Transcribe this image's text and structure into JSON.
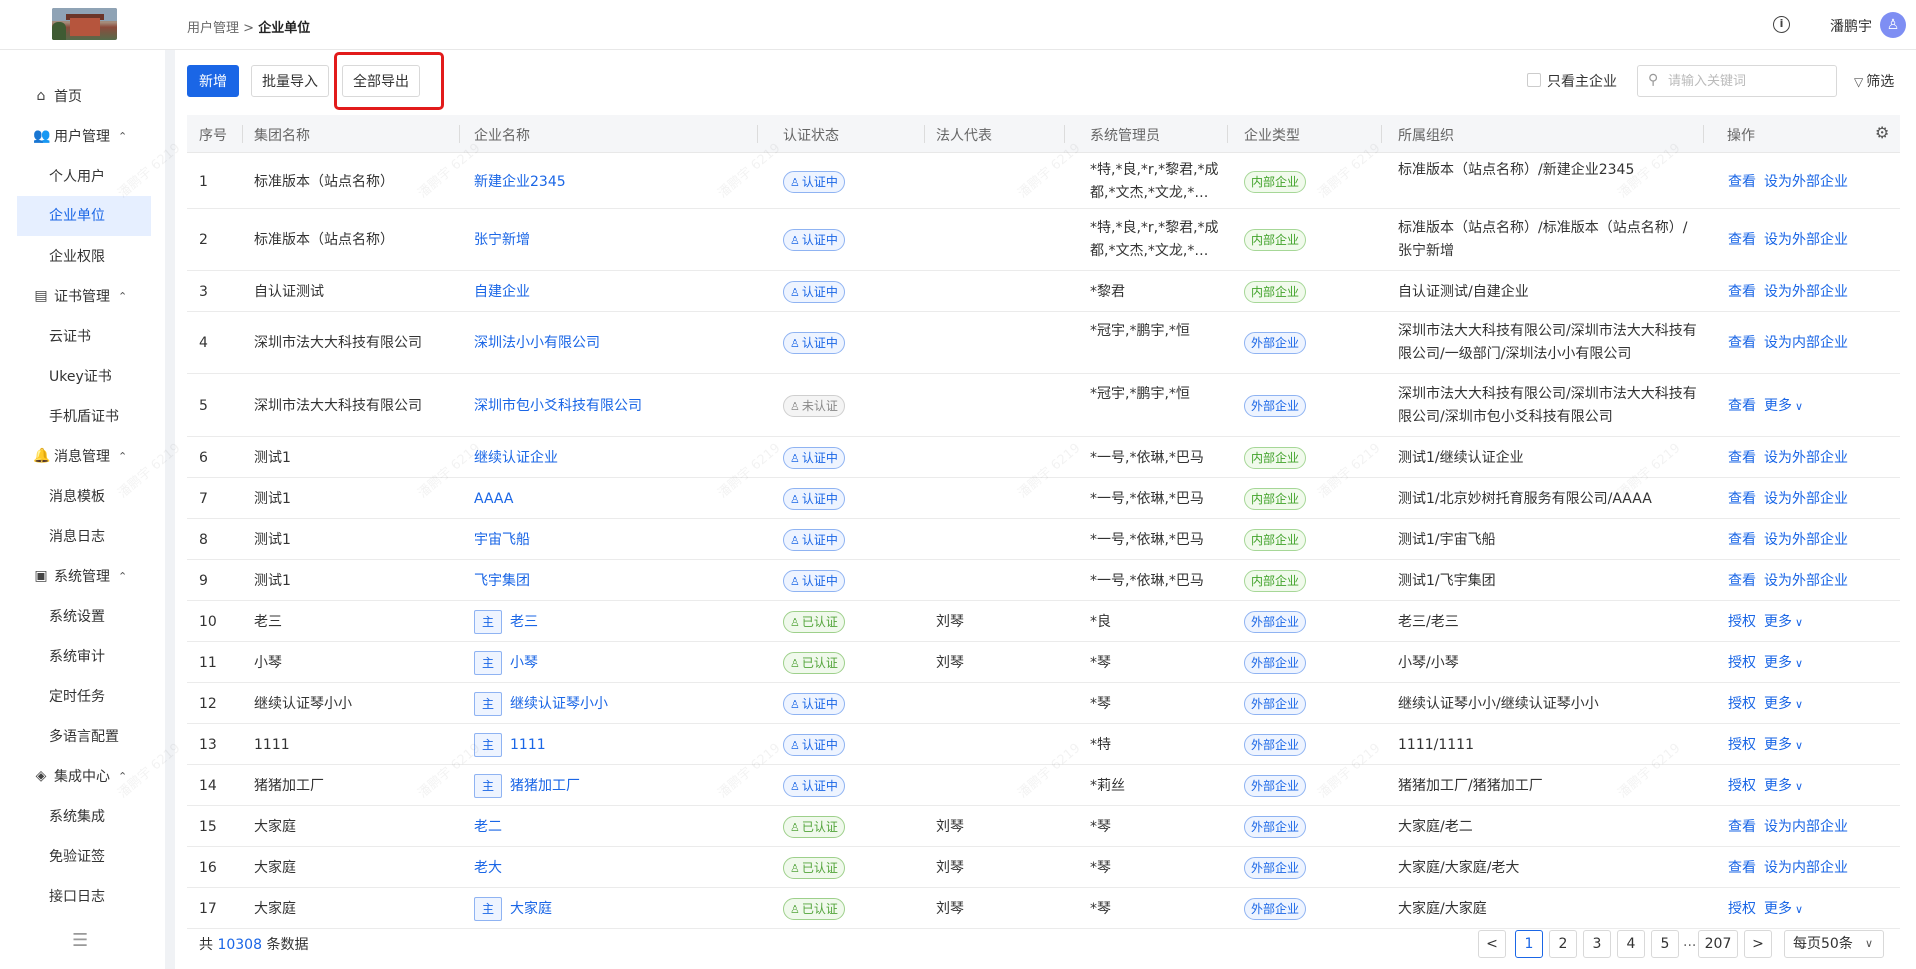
{
  "header": {
    "breadcrumb_parent": "用户管理",
    "breadcrumb_sep": ">",
    "breadcrumb_current": "企业单位",
    "info_icon": "i",
    "username": "潘鹏宇",
    "avatar_glyph": "♙"
  },
  "sidebar": {
    "home": "首页",
    "user_mgmt": "用户管理",
    "personal_user": "个人用户",
    "enterprise_unit": "企业单位",
    "enterprise_perm": "企业权限",
    "cert_mgmt": "证书管理",
    "cloud_cert": "云证书",
    "ukey_cert": "Ukey证书",
    "phone_cert": "手机盾证书",
    "msg_mgmt": "消息管理",
    "msg_template": "消息模板",
    "msg_log": "消息日志",
    "sys_mgmt": "系统管理",
    "sys_settings": "系统设置",
    "sys_audit": "系统审计",
    "sched_task": "定时任务",
    "multilang": "多语言配置",
    "integration": "集成中心",
    "sys_integration": "系统集成",
    "no_verify_sign": "免验证签",
    "api_log": "接口日志"
  },
  "toolbar": {
    "add": "新增",
    "batch_import": "批量导入",
    "export_all": "全部导出",
    "only_main": "只看主企业",
    "search_placeholder": "请输入关键词",
    "filter": "筛选"
  },
  "table": {
    "headers": {
      "index": "序号",
      "group": "集团名称",
      "company": "企业名称",
      "cert_status": "认证状态",
      "legal_rep": "法人代表",
      "sys_admin": "系统管理员",
      "ent_type": "企业类型",
      "org": "所属组织",
      "ops": "操作"
    },
    "main_tag": "主",
    "rows": [
      {
        "idx": "1",
        "group": "标准版本（站点名称）",
        "company": "新建企业2345",
        "status": "认证中",
        "legal": "",
        "admin": "*特,*良,*r,*黎君,*成都,*文杰,*文龙,*…",
        "type": "内部企业",
        "org": "标准版本（站点名称）/新建企业2345",
        "op1": "查看",
        "op2": "设为外部企业"
      },
      {
        "idx": "2",
        "group": "标准版本（站点名称）",
        "company": "张宁新增",
        "status": "认证中",
        "legal": "",
        "admin": "*特,*良,*r,*黎君,*成都,*文杰,*文龙,*…",
        "type": "内部企业",
        "org": "标准版本（站点名称）/标准版本（站点名称）/张宁新增",
        "op1": "查看",
        "op2": "设为外部企业"
      },
      {
        "idx": "3",
        "group": "自认证测试",
        "company": "自建企业",
        "status": "认证中",
        "legal": "",
        "admin": "*黎君",
        "type": "内部企业",
        "org": "自认证测试/自建企业",
        "op1": "查看",
        "op2": "设为外部企业"
      },
      {
        "idx": "4",
        "group": "深圳市法大大科技有限公司",
        "company": "深圳法小小有限公司",
        "status": "认证中",
        "legal": "",
        "admin": "*冠宇,*鹏宇,*恒",
        "type": "外部企业",
        "org": "深圳市法大大科技有限公司/深圳市法大大科技有限公司/一级部门/深圳法小小有限公司",
        "op1": "查看",
        "op2": "设为内部企业"
      },
      {
        "idx": "5",
        "group": "深圳市法大大科技有限公司",
        "company": "深圳市包小爻科技有限公司",
        "status": "未认证",
        "legal": "",
        "admin": "*冠宇,*鹏宇,*恒",
        "type": "外部企业",
        "org": "深圳市法大大科技有限公司/深圳市法大大科技有限公司/深圳市包小爻科技有限公司",
        "op1": "查看",
        "op2": "更多"
      },
      {
        "idx": "6",
        "group": "测试1",
        "company": "继续认证企业",
        "status": "认证中",
        "legal": "",
        "admin": "*一号,*依琳,*巴马",
        "type": "内部企业",
        "org": "测试1/继续认证企业",
        "op1": "查看",
        "op2": "设为外部企业"
      },
      {
        "idx": "7",
        "group": "测试1",
        "company": "AAAA",
        "status": "认证中",
        "legal": "",
        "admin": "*一号,*依琳,*巴马",
        "type": "内部企业",
        "org": "测试1/北京妙树托育服务有限公司/AAAA",
        "op1": "查看",
        "op2": "设为外部企业"
      },
      {
        "idx": "8",
        "group": "测试1",
        "company": "宇宙飞船",
        "status": "认证中",
        "legal": "",
        "admin": "*一号,*依琳,*巴马",
        "type": "内部企业",
        "org": "测试1/宇宙飞船",
        "op1": "查看",
        "op2": "设为外部企业"
      },
      {
        "idx": "9",
        "group": "测试1",
        "company": "飞宇集团",
        "status": "认证中",
        "legal": "",
        "admin": "*一号,*依琳,*巴马",
        "type": "内部企业",
        "org": "测试1/飞宇集团",
        "op1": "查看",
        "op2": "设为外部企业"
      },
      {
        "idx": "10",
        "group": "老三",
        "company": "老三",
        "status": "已认证",
        "legal": "刘琴",
        "admin": "*良",
        "type": "外部企业",
        "org": "老三/老三",
        "op1": "授权",
        "op2": "更多",
        "main": true
      },
      {
        "idx": "11",
        "group": "小琴",
        "company": "小琴",
        "status": "已认证",
        "legal": "刘琴",
        "admin": "*琴",
        "type": "外部企业",
        "org": "小琴/小琴",
        "op1": "授权",
        "op2": "更多",
        "main": true
      },
      {
        "idx": "12",
        "group": "继续认证琴小小",
        "company": "继续认证琴小小",
        "status": "认证中",
        "legal": "",
        "admin": "*琴",
        "type": "外部企业",
        "org": "继续认证琴小小/继续认证琴小小",
        "op1": "授权",
        "op2": "更多",
        "main": true
      },
      {
        "idx": "13",
        "group": "1111",
        "company": "1111",
        "status": "认证中",
        "legal": "",
        "admin": "*特",
        "type": "外部企业",
        "org": "1111/1111",
        "op1": "授权",
        "op2": "更多",
        "main": true
      },
      {
        "idx": "14",
        "group": "猪猪加工厂",
        "company": "猪猪加工厂",
        "status": "认证中",
        "legal": "",
        "admin": "*莉丝",
        "type": "外部企业",
        "org": "猪猪加工厂/猪猪加工厂",
        "op1": "授权",
        "op2": "更多",
        "main": true
      },
      {
        "idx": "15",
        "group": "大家庭",
        "company": "老二",
        "status": "已认证",
        "legal": "刘琴",
        "admin": "*琴",
        "type": "外部企业",
        "org": "大家庭/老二",
        "op1": "查看",
        "op2": "设为内部企业"
      },
      {
        "idx": "16",
        "group": "大家庭",
        "company": "老大",
        "status": "已认证",
        "legal": "刘琴",
        "admin": "*琴",
        "type": "外部企业",
        "org": "大家庭/大家庭/老大",
        "op1": "查看",
        "op2": "设为内部企业"
      },
      {
        "idx": "17",
        "group": "大家庭",
        "company": "大家庭",
        "status": "已认证",
        "legal": "刘琴",
        "admin": "*琴",
        "type": "外部企业",
        "org": "大家庭/大家庭",
        "op1": "授权",
        "op2": "更多",
        "main": true
      }
    ]
  },
  "footer": {
    "total_prefix": "共",
    "total_count": "10308",
    "total_suffix": "条数据",
    "prev": "<",
    "next": ">",
    "pages": [
      "1",
      "2",
      "3",
      "4",
      "5"
    ],
    "ellipsis": "...",
    "last_page": "207",
    "page_size": "每页50条"
  },
  "watermark_text": "潘鹏宇 6219",
  "colors": {
    "primary": "#1a66e6",
    "highlight": "#e21b1b"
  }
}
